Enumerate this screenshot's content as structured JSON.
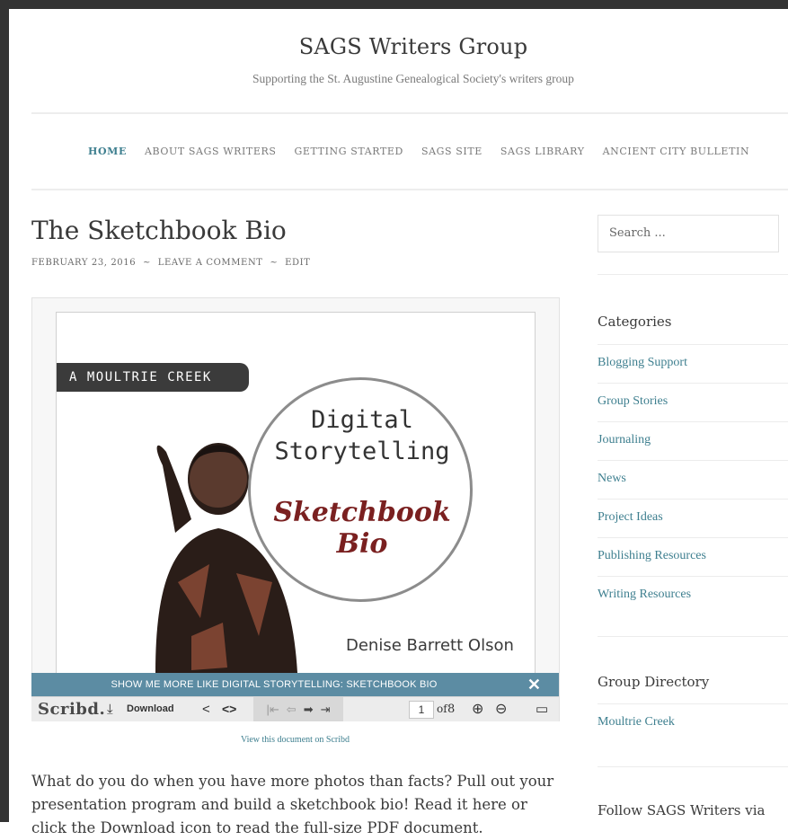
{
  "site": {
    "title": "SAGS Writers Group",
    "tagline": "Supporting the St. Augustine Genealogical Society's writers group"
  },
  "nav": {
    "items": [
      "HOME",
      "ABOUT SAGS WRITERS",
      "GETTING STARTED",
      "SAGS SITE",
      "SAGS LIBRARY",
      "ANCIENT CITY BULLETIN"
    ],
    "active_index": 0
  },
  "post": {
    "title": "The Sketchbook Bio",
    "date": "FEBRUARY 23, 2016",
    "separator": "~",
    "comment_link": "LEAVE A COMMENT",
    "edit_link": "EDIT",
    "body": "What do you do when you have more photos than facts? Pull out your presentation program and build a sketchbook bio! Read it here or click the Download icon to read the full-size PDF document."
  },
  "embed": {
    "doc_tag": "A MOULTRIE CREEK GUIDE",
    "doc_title_line1": "Digital",
    "doc_title_line2": "Storytelling",
    "doc_subtitle": "Sketchbook Bio",
    "doc_author": "Denise Barrett Olson",
    "banner_text": "SHOW ME MORE LIKE DIGITAL STORYTELLING: SKETCHBOOK BIO",
    "close_glyph": "✕",
    "toolbar": {
      "logo": "Scribd.",
      "download_label": "Download",
      "current_page": "1",
      "of_label": "of",
      "total_pages": "8"
    },
    "view_link": "View this document on Scribd"
  },
  "sidebar": {
    "search_placeholder": "Search ...",
    "categories_title": "Categories",
    "categories": [
      "Blogging Support",
      "Group Stories",
      "Journaling",
      "News",
      "Project Ideas",
      "Publishing Resources",
      "Writing Resources"
    ],
    "directory_title": "Group Directory",
    "directory_links": [
      "Moultrie Creek"
    ],
    "follow_title": "Follow SAGS Writers via"
  },
  "colors": {
    "accent": "#3e7f8f",
    "banner": "#5c8ca3",
    "subtitle": "#7a2020"
  }
}
